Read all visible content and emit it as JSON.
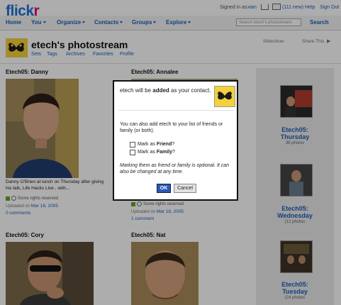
{
  "brand": {
    "logo_part1": "flick",
    "logo_part2": "r"
  },
  "account": {
    "signed_in_as": "Signed in as",
    "username": "xian",
    "mail_count": "(111 new)",
    "help": "Help",
    "sign_out": "Sign Out"
  },
  "nav": {
    "items": [
      {
        "label": "Home"
      },
      {
        "label": "You"
      },
      {
        "label": "Organize"
      },
      {
        "label": "Contacts"
      },
      {
        "label": "Groups"
      },
      {
        "label": "Explore"
      }
    ],
    "search_placeholder": "Search etech's photostream",
    "search_button": "Search"
  },
  "header": {
    "title": "etech's photostream",
    "links": [
      "Sets",
      "Tags",
      "Archives",
      "Favorites",
      "Profile"
    ],
    "slideshow": "Slideshow",
    "share": "Share This"
  },
  "photos": [
    {
      "title": "Etech05: Danny",
      "caption": "Danny O'Brien at lunch on Thursday after giving his talk, Life Hacks Live , with...",
      "rights": "Some rights reserved",
      "uploaded_prefix": "Uploaded on",
      "uploaded_date": "Mar 18, 2005",
      "comments": "0 comments"
    },
    {
      "title": "Etech05: Annalee",
      "rights": "Some rights reserved",
      "uploaded_prefix": "Uploaded on",
      "uploaded_date": "Mar 18, 2005",
      "comments": "1 comment"
    },
    {
      "title": "Etech05: Cory"
    },
    {
      "title": "Etech05: Nat"
    }
  ],
  "sets": [
    {
      "line1": "Etech05:",
      "line2": "Thursday",
      "count": "38 photos"
    },
    {
      "line1": "Etech05:",
      "line2": "Wednesday",
      "count": "(12 photos"
    },
    {
      "line1": "Etech05:",
      "line2": "Tuesday",
      "count": "(24 photos"
    }
  ],
  "dialog": {
    "heading_pre": "etech will be ",
    "heading_bold": "added",
    "heading_post": " as your contact.",
    "body_line1": "You can also add etech to your list of friends or family (or both).",
    "friend_pre": "Mark as ",
    "friend_bold": "Friend",
    "friend_post": "?",
    "family_pre": "Mark as ",
    "family_bold": "Family",
    "family_post": "?",
    "note": "Marking them as friend or family is optional. It can also be changed at any time.",
    "ok": "OK",
    "cancel": "Cancel"
  },
  "colors": {
    "flickr_blue": "#1e73d8",
    "flickr_pink": "#e6007e",
    "ok_button": "#2b59b6"
  }
}
